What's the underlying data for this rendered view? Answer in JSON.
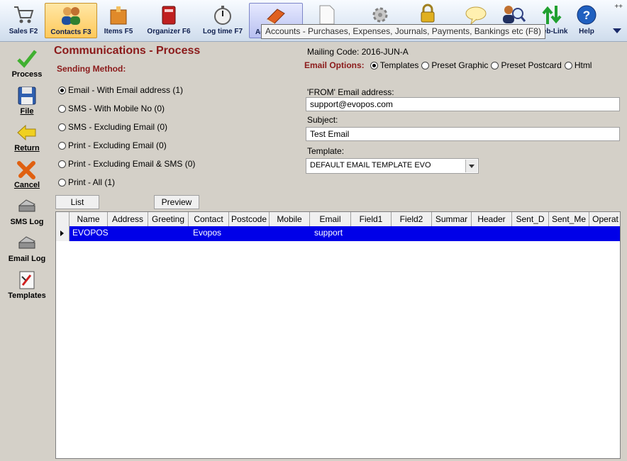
{
  "toolbar": {
    "items": [
      {
        "label": "Sales F2",
        "icon": "cart-icon"
      },
      {
        "label": "Contacts F3",
        "icon": "contacts-icon",
        "active": true
      },
      {
        "label": "Items F5",
        "icon": "box-icon"
      },
      {
        "label": "Organizer F6",
        "icon": "organizer-icon"
      },
      {
        "label": "Log time F7",
        "icon": "stopwatch-icon"
      },
      {
        "label": "Ac",
        "icon": "book-icon"
      },
      {
        "label": "Web-Link",
        "icon": "arrows-icon"
      },
      {
        "label": "Help",
        "icon": "help-icon"
      }
    ],
    "tooltip": "Accounts - Purchases, Expenses, Journals, Payments, Bankings etc (F8)",
    "corner": "++"
  },
  "sidebar": {
    "items": [
      {
        "label": "Process",
        "icon": "checkmark-icon"
      },
      {
        "label": "File",
        "icon": "floppy-disk-icon"
      },
      {
        "label": "Return",
        "icon": "back-arrow-icon"
      },
      {
        "label": "Cancel",
        "icon": "cancel-icon"
      },
      {
        "label": "SMS Log",
        "icon": "printer-icon"
      },
      {
        "label": "Email Log",
        "icon": "printer-icon"
      },
      {
        "label": "Templates",
        "icon": "template-icon"
      }
    ]
  },
  "main": {
    "title": "Communications - Process",
    "sending_method_label": "Sending Method:",
    "sending_options": [
      "Email - With Email address (1)",
      "SMS - With Mobile No (0)",
      "SMS - Excluding Email (0)",
      "Print - Excluding Email (0)",
      "Print - Excluding Email & SMS (0)",
      "Print - All (1)"
    ],
    "sending_selected": 0,
    "mailing_code": "Mailing Code: 2016-JUN-A",
    "email_options_label": "Email Options:",
    "email_options": [
      "Templates",
      "Preset Graphic",
      "Preset Postcard",
      "Html"
    ],
    "email_option_selected": 0,
    "from_label": "'FROM' Email address:",
    "from_value": "support@evopos.com",
    "subject_label": "Subject:",
    "subject_value": "Test Email",
    "template_label": "Template:",
    "template_value": "DEFAULT EMAIL TEMPLATE EVO",
    "list_button": "List",
    "preview_button": "Preview"
  },
  "grid": {
    "columns": [
      "Name",
      "Address",
      "Greeting",
      "Contact",
      "Postcode",
      "Mobile",
      "Email",
      "Field1",
      "Field2",
      "Summar",
      "Header",
      "Sent_D",
      "Sent_Me",
      "Operat"
    ],
    "rows": [
      {
        "Name": "EVOPOS",
        "Contact": "Evopos",
        "Email": "support"
      }
    ]
  },
  "colors": {
    "title": "#8b1a1a",
    "selected_row": "#0000e8",
    "active_toolbar": "#ffc95a"
  }
}
